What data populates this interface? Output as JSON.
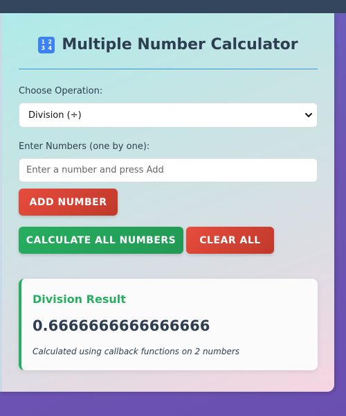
{
  "header": {
    "title": "Multiple Number Calculator",
    "icon_digits": [
      "1",
      "2",
      "3",
      "4"
    ]
  },
  "operation": {
    "label": "Choose Operation:",
    "selected": "Division (÷)"
  },
  "numbers": {
    "label": "Enter Numbers (one by one):",
    "placeholder": "Enter a number and press Add",
    "value": ""
  },
  "buttons": {
    "add": "ADD NUMBER",
    "calculate": "CALCULATE ALL NUMBERS",
    "clear": "CLEAR ALL"
  },
  "result": {
    "title": "Division Result",
    "value": "0.6666666666666666",
    "note": "Calculated using callback functions on 2 numbers"
  },
  "colors": {
    "accent_blue": "#3498db",
    "danger_red": "#e74c3c",
    "success_green": "#27ae60",
    "text_dark": "#2c3e50",
    "top_bar": "#34465e"
  }
}
